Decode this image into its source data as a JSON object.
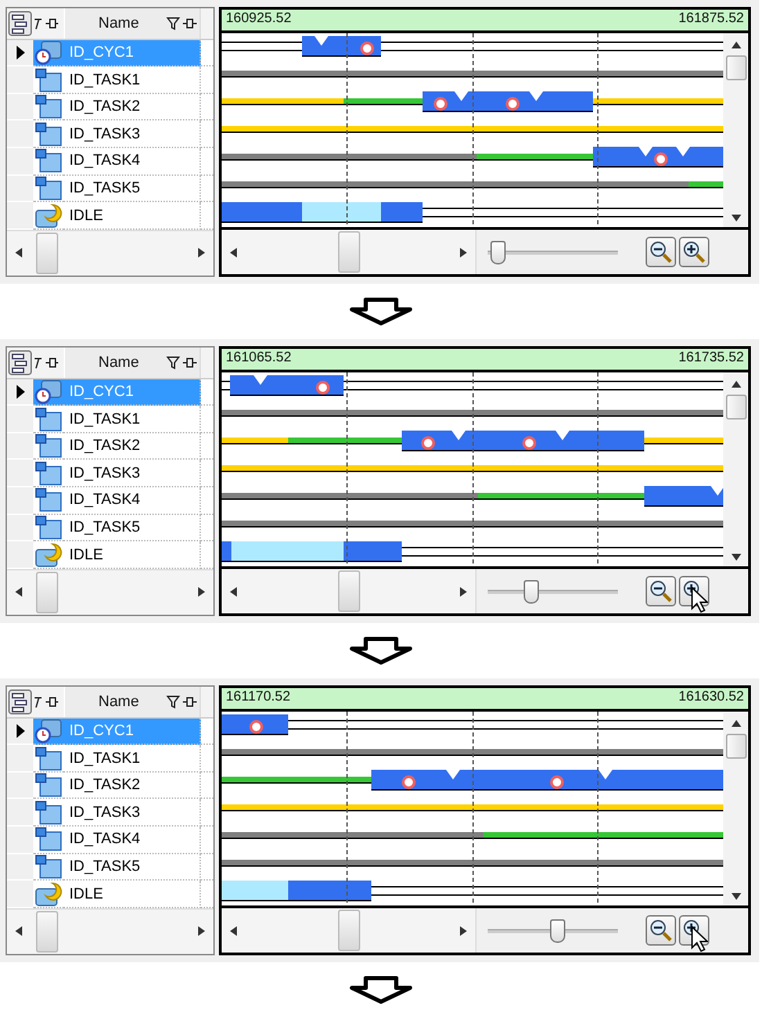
{
  "panels": [
    {
      "grid": {
        "column": "Name",
        "rows": [
          {
            "name": "ID_CYC1",
            "kind": "cyclic",
            "selected": true
          },
          {
            "name": "ID_TASK1",
            "kind": "task",
            "selected": false
          },
          {
            "name": "ID_TASK2",
            "kind": "task",
            "selected": false
          },
          {
            "name": "ID_TASK3",
            "kind": "task",
            "selected": false
          },
          {
            "name": "ID_TASK4",
            "kind": "task",
            "selected": false
          },
          {
            "name": "ID_TASK5",
            "kind": "task",
            "selected": false
          },
          {
            "name": "IDLE",
            "kind": "idle",
            "selected": false
          }
        ]
      },
      "timeline": {
        "start": "160925.52",
        "end": "161875.52",
        "zoom_slider": {
          "level": 0.05
        },
        "pointer_on_zoom_in": false
      }
    },
    {
      "grid": {
        "column": "Name",
        "rows": [
          {
            "name": "ID_CYC1",
            "kind": "cyclic",
            "selected": true
          },
          {
            "name": "ID_TASK1",
            "kind": "task",
            "selected": false
          },
          {
            "name": "ID_TASK2",
            "kind": "task",
            "selected": false
          },
          {
            "name": "ID_TASK3",
            "kind": "task",
            "selected": false
          },
          {
            "name": "ID_TASK4",
            "kind": "task",
            "selected": false
          },
          {
            "name": "ID_TASK5",
            "kind": "task",
            "selected": false
          },
          {
            "name": "IDLE",
            "kind": "idle",
            "selected": false
          }
        ]
      },
      "timeline": {
        "start": "161065.52",
        "end": "161735.52",
        "zoom_slider": {
          "level": 0.33
        },
        "pointer_on_zoom_in": true
      }
    },
    {
      "grid": {
        "column": "Name",
        "rows": [
          {
            "name": "ID_CYC1",
            "kind": "cyclic",
            "selected": true
          },
          {
            "name": "ID_TASK1",
            "kind": "task",
            "selected": false
          },
          {
            "name": "ID_TASK2",
            "kind": "task",
            "selected": false
          },
          {
            "name": "ID_TASK3",
            "kind": "task",
            "selected": false
          },
          {
            "name": "ID_TASK4",
            "kind": "task",
            "selected": false
          },
          {
            "name": "ID_TASK5",
            "kind": "task",
            "selected": false
          },
          {
            "name": "IDLE",
            "kind": "idle",
            "selected": false
          }
        ]
      },
      "timeline": {
        "start": "161170.52",
        "end": "161630.52",
        "zoom_slider": {
          "level": 0.55
        },
        "pointer_on_zoom_in": true
      }
    }
  ]
}
